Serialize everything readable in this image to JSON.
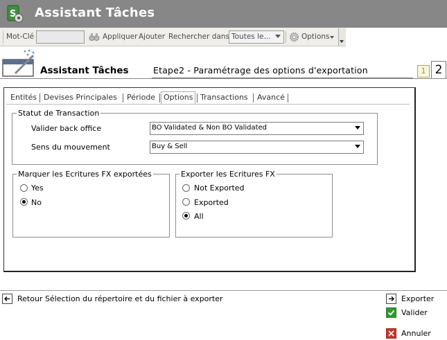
{
  "app": {
    "title": "Assistant Tâches"
  },
  "toolbar": {
    "keyword_label": "Mot-Clé",
    "keyword_value": "",
    "apply_label": "Appliquer",
    "add_label": "Ajouter",
    "search_in_label": "Rechercher dans",
    "search_in_value": "Toutes le...",
    "options_label": "Options"
  },
  "wizard": {
    "title": "Assistant Tâches",
    "step_title": "Etape2 - Paramétrage des options d'exportation",
    "steps": [
      "1",
      "2"
    ],
    "current_step": "2"
  },
  "tabs": [
    {
      "label": "Entités"
    },
    {
      "label": "Devises Principales"
    },
    {
      "label": "Période"
    },
    {
      "label": "Options"
    },
    {
      "label": "Transactions"
    },
    {
      "label": "Avancé"
    }
  ],
  "active_tab": "Options",
  "transaction_status": {
    "legend": "Statut de Transaction",
    "back_office_label": "Valider back office",
    "back_office_value": "BO Validated & Non BO Validated",
    "direction_label": "Sens du mouvement",
    "direction_value": "Buy & Sell"
  },
  "mark_entries": {
    "legend": "Marquer les Ecritures FX exportées",
    "options": [
      {
        "label": "Yes",
        "selected": false
      },
      {
        "label": "No",
        "selected": true
      }
    ]
  },
  "export_entries": {
    "legend": "Exporter les Ecritures FX",
    "options": [
      {
        "label": "Not Exported",
        "selected": false
      },
      {
        "label": "Exported",
        "selected": false
      },
      {
        "label": "All",
        "selected": true
      }
    ]
  },
  "footer": {
    "back_label": "Retour Sélection du répertoire et du fichier à exporter",
    "export_label": "Exporter",
    "validate_label": "Valider",
    "cancel_label": "Annuler"
  },
  "colors": {
    "titlebar": "#878787",
    "toolbar": "#efeeea",
    "validate_icon": "#2e9a2e",
    "cancel_icon": "#c0392b"
  }
}
